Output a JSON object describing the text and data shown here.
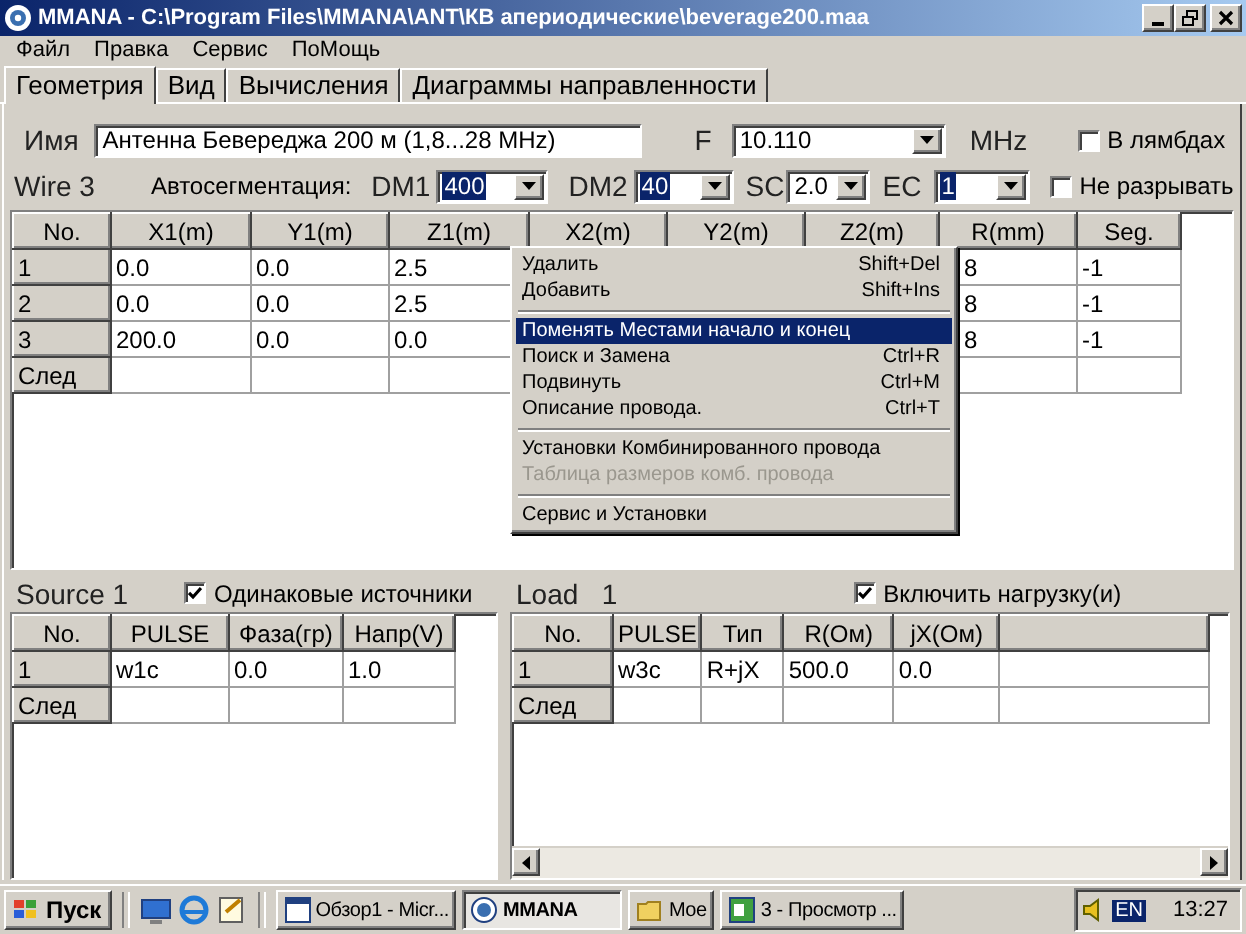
{
  "window": {
    "title": "MMANA - C:\\Program Files\\MMANA\\ANT\\КВ апериодические\\beverage200.maa"
  },
  "menu": [
    "Файл",
    "Правка",
    "Сервис",
    "ПоМощь"
  ],
  "tabs": [
    {
      "label": "Геометрия",
      "selected": true
    },
    {
      "label": "Вид",
      "selected": false
    },
    {
      "label": "Вычисления",
      "selected": false
    },
    {
      "label": "Диаграммы направленности",
      "selected": false
    }
  ],
  "name": {
    "label": "Имя",
    "value": "Антенна Бевереджа 200 м (1,8...28 MHz)"
  },
  "frequency": {
    "label": "F",
    "value": "10.110",
    "unit": "MHz"
  },
  "wire_label": "Wire 3",
  "autoseg_label": "Автосегментация:",
  "combos": [
    {
      "label": "DM1",
      "value": "400",
      "selected": true
    },
    {
      "label": "DM2",
      "value": "40",
      "selected": true
    },
    {
      "label": "SC",
      "value": "2.0",
      "selected": false
    },
    {
      "label": "EC",
      "value": "1",
      "selected": true
    }
  ],
  "options": [
    {
      "label": "В лямбдах",
      "checked": false
    },
    {
      "label": "Не разрывать",
      "checked": false
    }
  ],
  "wires": {
    "columns": [
      "No.",
      "X1(m)",
      "Y1(m)",
      "Z1(m)",
      "X2(m)",
      "Y2(m)",
      "Z2(m)",
      "R(mm)",
      "Seg."
    ],
    "rows": [
      [
        "1",
        "0.0",
        "0.0",
        "2.5",
        null,
        null,
        null,
        "8",
        "-1"
      ],
      [
        "2",
        "0.0",
        "0.0",
        "2.5",
        null,
        null,
        null,
        "8",
        "-1"
      ],
      [
        "3",
        "200.0",
        "0.0",
        "0.0",
        null,
        null,
        null,
        "8",
        "-1"
      ],
      [
        "След"
      ]
    ]
  },
  "context_menu": [
    {
      "kind": "item",
      "label": "Удалить",
      "shortcut": "Shift+Del",
      "selected": false,
      "disabled": false
    },
    {
      "kind": "item",
      "label": "Добавить",
      "shortcut": "Shift+Ins",
      "selected": false,
      "disabled": false
    },
    {
      "kind": "separator"
    },
    {
      "kind": "item",
      "label": "Поменять Местами начало и конец",
      "selected": true,
      "disabled": false
    },
    {
      "kind": "item",
      "label": "Поиск и Замена",
      "shortcut": "Ctrl+R",
      "selected": false,
      "disabled": false
    },
    {
      "kind": "item",
      "label": "Подвинуть",
      "shortcut": "Ctrl+M",
      "selected": false,
      "disabled": false
    },
    {
      "kind": "item",
      "label": "Описание провода.",
      "shortcut": "Ctrl+T",
      "selected": false,
      "disabled": false
    },
    {
      "kind": "separator"
    },
    {
      "kind": "item",
      "label": "Установки Комбинированного провода",
      "selected": false,
      "disabled": false
    },
    {
      "kind": "item",
      "label": "Таблица размеров комб. провода",
      "selected": false,
      "disabled": true
    },
    {
      "kind": "separator"
    },
    {
      "kind": "item",
      "label": "Сервис и Установки",
      "selected": false,
      "disabled": false
    }
  ],
  "source": {
    "title": "Source 1",
    "option": {
      "label": "Одинаковые источники",
      "checked": true
    },
    "columns": [
      "No.",
      "PULSE",
      "Фаза(гр)",
      "Напр(V)"
    ],
    "rows": [
      [
        "1",
        "w1c",
        "0.0",
        "1.0"
      ],
      [
        "След"
      ]
    ]
  },
  "load": {
    "title": "Load   1",
    "option": {
      "label": "Включить нагрузку(и)",
      "checked": true
    },
    "columns": [
      "No.",
      "PULSE",
      "Тип",
      "R(Ом)",
      "jX(Ом)"
    ],
    "rows": [
      [
        "1",
        "w3c",
        "R+jX",
        "500.0",
        "0.0"
      ],
      [
        "След"
      ]
    ]
  },
  "taskbar": {
    "start": "Пуск",
    "tasks": [
      {
        "label": "Обзор1 - Micr...",
        "selected": false
      },
      {
        "label": "MMANA",
        "selected": true
      },
      {
        "label": "Moe",
        "selected": false
      },
      {
        "label": "3 - Просмотр ...",
        "selected": false
      }
    ],
    "language": "EN",
    "time": "13:27"
  }
}
